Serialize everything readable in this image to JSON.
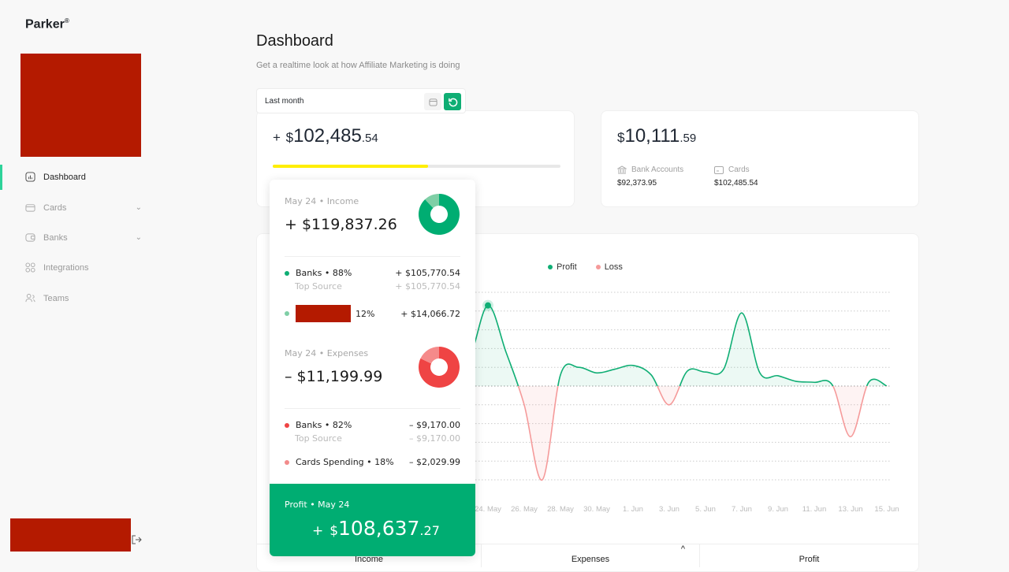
{
  "brand": {
    "name": "Parker",
    "mark": "®"
  },
  "sidebar": {
    "items": [
      {
        "label": "Dashboard",
        "icon": "chart-icon",
        "active": true
      },
      {
        "label": "Cards",
        "icon": "card-icon",
        "expandable": true
      },
      {
        "label": "Banks",
        "icon": "wallet-icon",
        "expandable": true
      },
      {
        "label": "Integrations",
        "icon": "grid-icon"
      },
      {
        "label": "Teams",
        "icon": "users-icon"
      }
    ],
    "logout_icon": "logout-icon"
  },
  "header": {
    "title": "Dashboard",
    "subtitle": "Get a realtime look at how Affiliate Marketing is doing"
  },
  "date_filter": {
    "value": "Last month"
  },
  "income_card": {
    "sign": "+",
    "currency": "$",
    "whole": "102,485",
    "cents": ".54",
    "progress_percent": 54,
    "progress_color": "#ffee00"
  },
  "balance_card": {
    "currency": "$",
    "whole": "10,111",
    "cents": ".59",
    "bank_label": "Bank Accounts",
    "bank_value": "$92,373.95",
    "cards_label": "Cards",
    "cards_value": "$102,485.54"
  },
  "tooltip": {
    "income": {
      "head": "May 24 • Income",
      "amount": "+ $119,837.26",
      "slices": [
        88,
        12
      ],
      "rows": [
        {
          "label": "Banks • 88%",
          "value": "+ $105,770.54",
          "color": "#0fae74"
        },
        {
          "label": "Top Source",
          "value": "+ $105,770.54"
        },
        {
          "label": "12%",
          "value": "+ $14,066.72",
          "color": "#7fcfa6"
        }
      ]
    },
    "expenses": {
      "head": "May 24 • Expenses",
      "amount": "– $11,199.99",
      "slices": [
        82,
        18
      ],
      "rows": [
        {
          "label": "Banks • 82%",
          "value": "– $9,170.00",
          "color": "#ef4444"
        },
        {
          "label": "Top Source",
          "value": "– $9,170.00"
        },
        {
          "label": "Cards Spending • 18%",
          "value": "– $2,029.99",
          "color": "#f28b8b"
        }
      ]
    },
    "profit": {
      "head": "Profit • May 24",
      "sign": "+",
      "currency": "$",
      "whole": "108,637",
      "cents": ".27"
    }
  },
  "chart_data": {
    "type": "area",
    "legend": [
      {
        "name": "Profit",
        "color": "#0fae74"
      },
      {
        "name": "Loss",
        "color": "#f59a9a"
      }
    ],
    "legend_placement": "top-center",
    "grid": true,
    "x_ticks": [
      "24. May",
      "26. May",
      "28. May",
      "30. May",
      "1. Jun",
      "3. Jun",
      "5. Jun",
      "7. Jun",
      "9. Jun",
      "11. Jun",
      "13. Jun",
      "15. Jun"
    ],
    "x": [
      "22 May",
      "23 May",
      "24 May",
      "25 May",
      "26 May",
      "27 May",
      "28 May",
      "29 May",
      "30 May",
      "31 May",
      "1 Jun",
      "2 Jun",
      "3 Jun",
      "4 Jun",
      "5 Jun",
      "6 Jun",
      "7 Jun",
      "8 Jun",
      "9 Jun",
      "10 Jun",
      "11 Jun",
      "12 Jun",
      "13 Jun",
      "14 Jun",
      "15 Jun"
    ],
    "y": [
      0.5,
      1.5,
      4.3,
      1.8,
      -1.0,
      -5.0,
      0.6,
      1.0,
      0.7,
      0.9,
      1.1,
      0.6,
      -1.0,
      0.8,
      0.75,
      0.9,
      3.9,
      0.7,
      0.55,
      0.25,
      0.2,
      0.05,
      -2.7,
      0.2,
      0
    ],
    "ylim": [
      -5,
      5
    ],
    "highlight": "24 May"
  },
  "bottom_tabs": [
    "Income",
    "Expenses",
    "Profit"
  ]
}
